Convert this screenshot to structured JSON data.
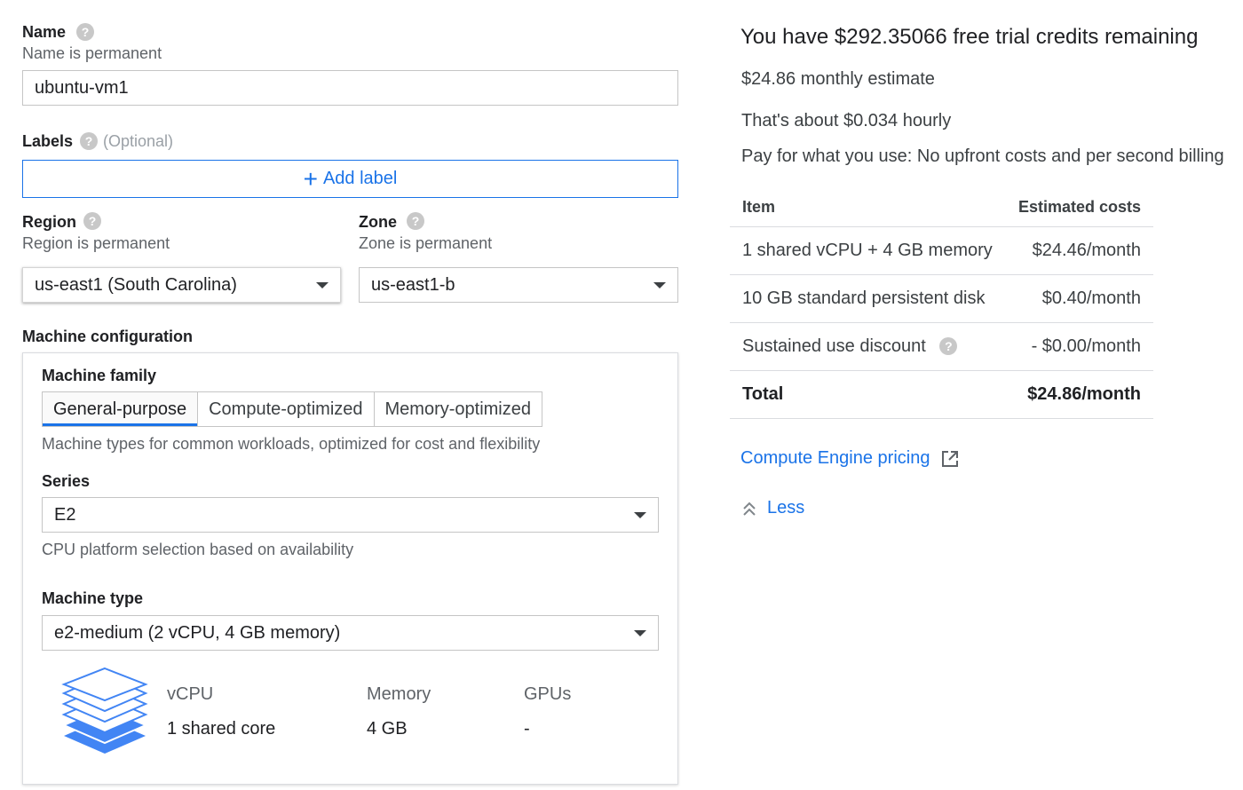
{
  "name_field": {
    "label": "Name",
    "hint": "Name is permanent",
    "value": "ubuntu-vm1",
    "help_icon": "help-icon"
  },
  "labels_field": {
    "label": "Labels",
    "optional": "(Optional)",
    "add_label": "Add label"
  },
  "region_field": {
    "label": "Region",
    "hint": "Region is permanent",
    "value": "us-east1 (South Carolina)"
  },
  "zone_field": {
    "label": "Zone",
    "hint": "Zone is permanent",
    "value": "us-east1-b"
  },
  "machine_config": {
    "heading": "Machine configuration",
    "family_label": "Machine family",
    "tabs": [
      "General-purpose",
      "Compute-optimized",
      "Memory-optimized"
    ],
    "active_tab": "General-purpose",
    "family_desc": "Machine types for common workloads, optimized for cost and flexibility",
    "series_label": "Series",
    "series_value": "E2",
    "series_desc": "CPU platform selection based on availability",
    "type_label": "Machine type",
    "type_value": "e2-medium (2 vCPU, 4 GB memory)",
    "specs": {
      "vcpu_head": "vCPU",
      "vcpu_val": "1 shared core",
      "memory_head": "Memory",
      "memory_val": "4 GB",
      "gpus_head": "GPUs",
      "gpus_val": "-"
    }
  },
  "pricing": {
    "credits": "You have $292.35066 free trial credits remaining",
    "monthly": "$24.86 monthly estimate",
    "hourly": "That's about $0.034 hourly",
    "billing": "Pay for what you use: No upfront costs and per second billing",
    "table": {
      "col_item": "Item",
      "col_cost": "Estimated costs",
      "rows": [
        {
          "item": "1 shared vCPU + 4 GB memory",
          "cost": "$24.46/month"
        },
        {
          "item": "10 GB standard persistent disk",
          "cost": "$0.40/month"
        },
        {
          "item": "Sustained use discount",
          "cost": "- $0.00/month"
        }
      ],
      "total_label": "Total",
      "total_cost": "$24.86/month"
    },
    "pricing_link": "Compute Engine pricing",
    "less_link": "Less"
  },
  "colors": {
    "accent": "#1a73e8",
    "stack_icon": "#4285f4"
  }
}
